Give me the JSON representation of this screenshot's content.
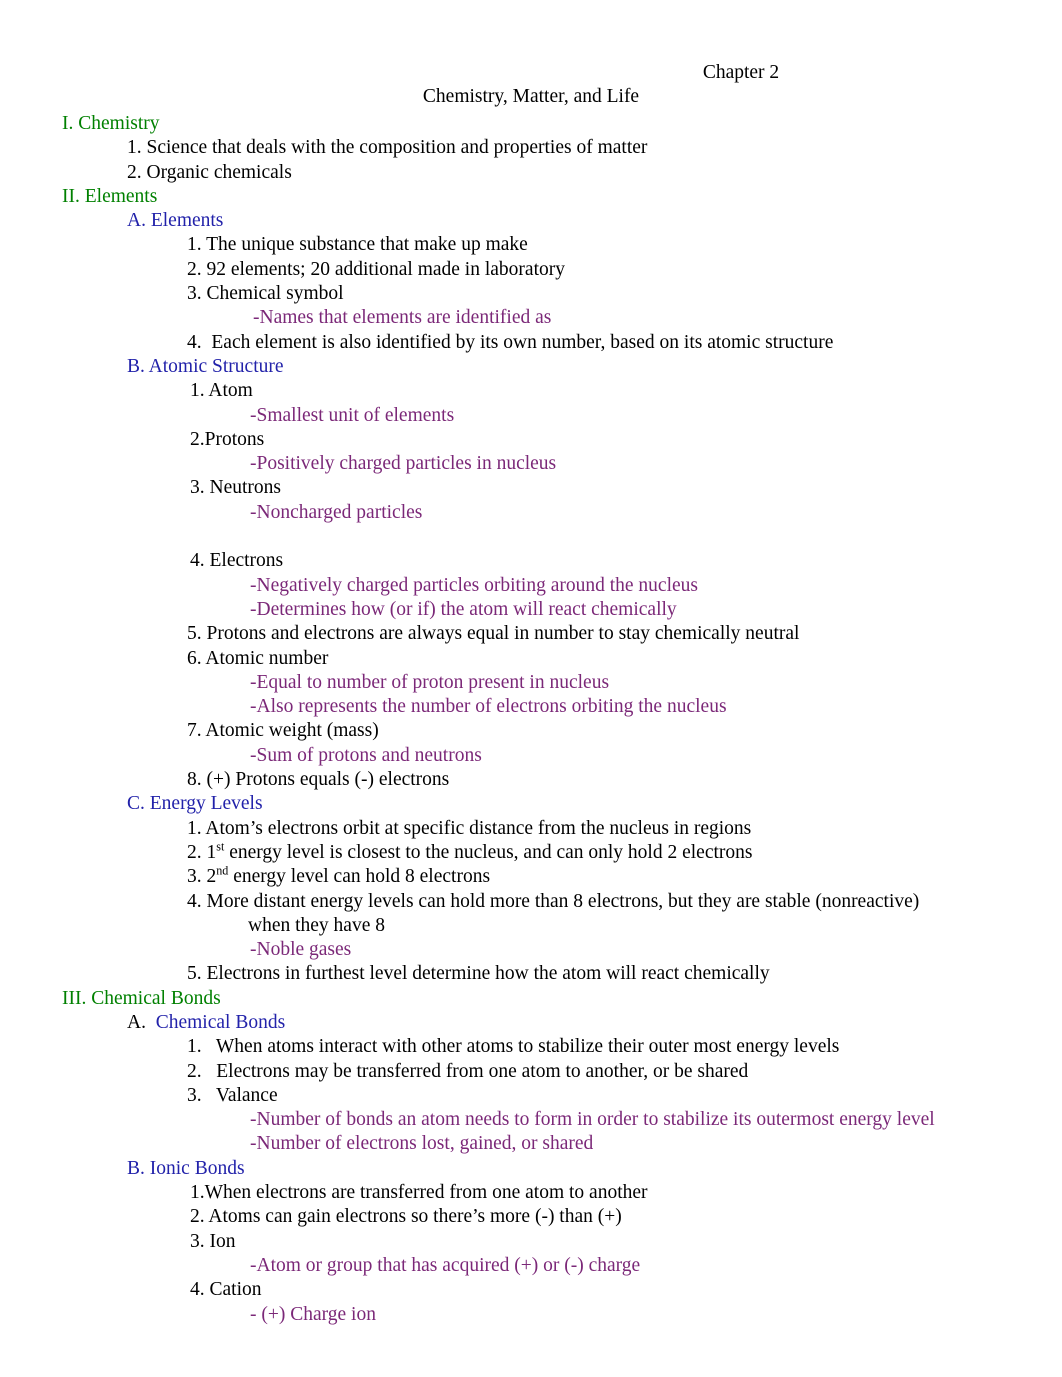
{
  "colors": {
    "roman_heading": "#008000",
    "letter_heading": "#2222aa",
    "note": "#7b2878",
    "body": "#000000",
    "page_background": "#ffffff"
  },
  "header": {
    "chapter": "Chapter 2",
    "subtitle": "Chemistry, Matter, and Life"
  },
  "outline": {
    "l01": "I. Chemistry",
    "l02": "1. Science that deals with the composition and properties of matter",
    "l03": "2. Organic chemicals",
    "l04": "II. Elements",
    "l05": "A. Elements",
    "l06": "1. The unique substance that make up make",
    "l07": "2. 92 elements; 20 additional made in laboratory",
    "l08": "3. Chemical symbol",
    "l09": "-Names that elements are identified as",
    "l10": "4.  Each element is also identified by its own number, based on its atomic structure",
    "l11": "B. Atomic Structure",
    "l12": "1. Atom",
    "l13": "-Smallest unit of elements",
    "l14": "2.Protons",
    "l15": "-Positively charged particles in nucleus",
    "l16": "3. Neutrons",
    "l17": "-Noncharged particles",
    "l18": "4. Electrons",
    "l19": "-Negatively charged particles orbiting around the nucleus",
    "l20": "-Determines how (or if) the atom will react chemically",
    "l21": "5. Protons and electrons are always equal in number to stay chemically neutral",
    "l22": "6. Atomic number",
    "l23": "-Equal to number of proton present in nucleus",
    "l24": "-Also represents the number of electrons orbiting the nucleus",
    "l25": "7. Atomic weight (mass)",
    "l26": "-Sum of protons and neutrons",
    "l27": "8. (+) Protons equals (-) electrons",
    "l28": "C. Energy Levels",
    "l29": "1. Atom’s electrons orbit at specific distance from the nucleus in regions",
    "l30_pre": "2. 1",
    "l30_sup": "st",
    "l30_post": " energy level is closest to the nucleus, and can only hold 2 electrons",
    "l31_pre": "3. 2",
    "l31_sup": "nd",
    "l31_post": " energy level can hold 8 electrons",
    "l32": "4. More distant energy levels can hold more than 8 electrons, but they are stable (nonreactive)",
    "l33": "when they have 8",
    "l34": "-Noble gases",
    "l35": "5. Electrons in furthest level determine how the atom will react chemically",
    "l36": "III. Chemical Bonds",
    "l37_letter": "A. ",
    "l37_title": " Chemical Bonds",
    "l38": "1.   When atoms interact with other atoms to stabilize their outer most energy levels",
    "l39": "2.   Electrons may be transferred from one atom to another, or be shared",
    "l40": "3.   Valance",
    "l41": "-Number of bonds an atom needs to form in order to stabilize its outermost energy level",
    "l42": "-Number of electrons lost, gained, or shared",
    "l43": "B. Ionic Bonds",
    "l44": "1.When electrons are transferred from one atom to another",
    "l45": "2. Atoms can gain electrons so there’s more (-) than (+)",
    "l46": "3. Ion",
    "l47": "-Atom or group that has acquired (+) or (-) charge",
    "l48": "4. Cation",
    "l49": "- (+) Charge ion"
  }
}
